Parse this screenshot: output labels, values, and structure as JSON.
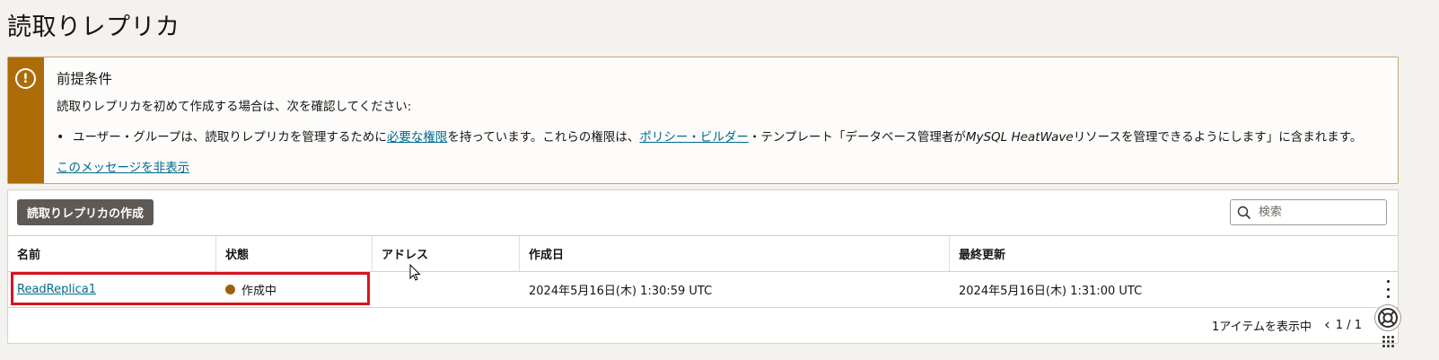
{
  "page": {
    "title": "読取りレプリカ"
  },
  "notice": {
    "title": "前提条件",
    "intro": "読取りレプリカを初めて作成する場合は、次を確認してください:",
    "bullet": {
      "part1": "ユーザー・グループは、読取りレプリカを管理するために",
      "link1": "必要な権限",
      "part2": "を持っています。これらの権限は、",
      "link2": "ポリシー・ビルダー",
      "part3": "・テンプレート「データベース管理者が",
      "em": "MySQL HeatWave",
      "part4": "リソースを管理できるようにします」に含まれます。"
    },
    "hide_link": "このメッセージを非表示",
    "icon": "warning-icon",
    "accent_color": "#ad6c08"
  },
  "toolbar": {
    "create_button": "読取りレプリカの作成",
    "search_placeholder": "検索"
  },
  "table": {
    "headers": {
      "name": "名前",
      "state": "状態",
      "address": "アドレス",
      "created": "作成日",
      "updated": "最終更新"
    },
    "rows": [
      {
        "name": "ReadReplica1",
        "state": "作成中",
        "state_color": "#a05e0c",
        "address": "",
        "created": "2024年5月16日(木) 1:30:59 UTC",
        "updated": "2024年5月16日(木) 1:31:00 UTC"
      }
    ]
  },
  "footer": {
    "showing": "1アイテムを表示中",
    "page": "1 / 1"
  }
}
